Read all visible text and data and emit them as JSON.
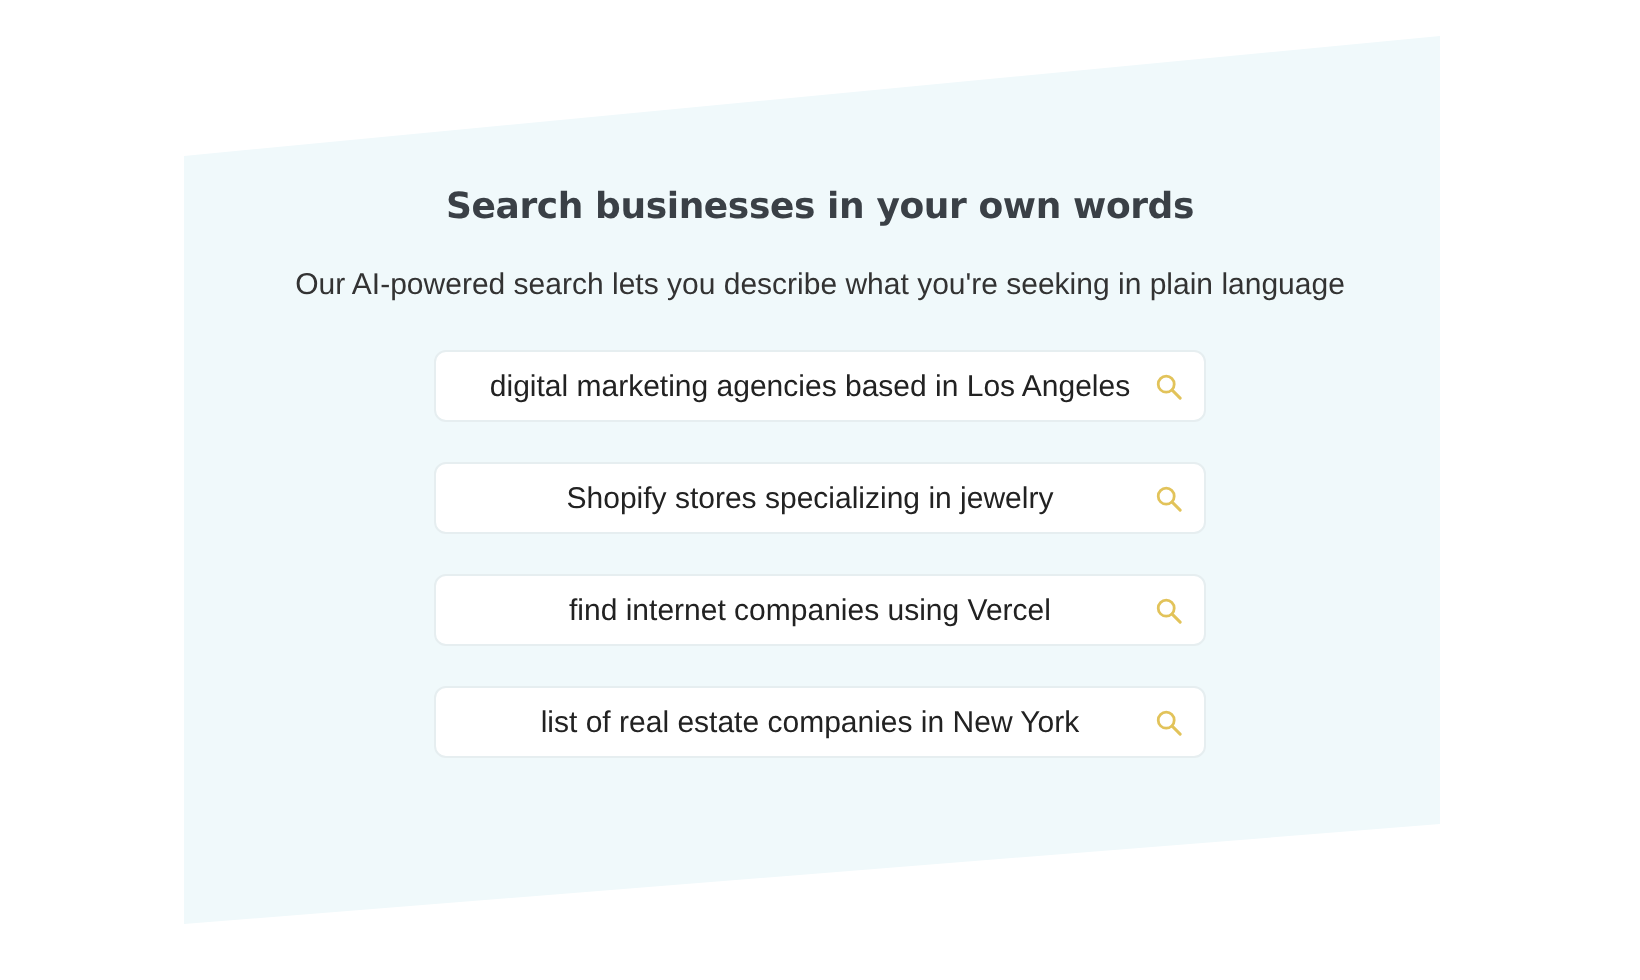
{
  "heading": "Search businesses in your own words",
  "subtitle": "Our AI-powered search lets you describe what you're seeking in plain language",
  "examples": [
    {
      "query": "digital marketing agencies based in Los Angeles"
    },
    {
      "query": "Shopify stores specializing in jewelry"
    },
    {
      "query": "find internet companies using Vercel"
    },
    {
      "query": "list of real estate companies in New York"
    }
  ]
}
